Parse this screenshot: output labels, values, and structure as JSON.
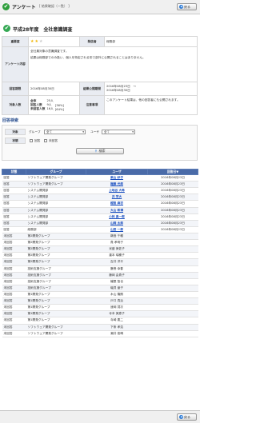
{
  "header": {
    "app_title": "アンケート",
    "breadcrumb": "[ 結果確認（一覧） ]",
    "back_label": "戻る"
  },
  "survey": {
    "title": "平成28年度　全社意識調査"
  },
  "info": {
    "importance_label": "重要度",
    "importance_value": 2,
    "importance_max": 3,
    "sender_label": "発信者",
    "sender_value": "総務部",
    "content_label": "アンケート内容",
    "content_lines": [
      "全社員対象の意識調査です。",
      "結果は総務部でのみ扱い、個人を特定される形で部外に公開されることはありません。"
    ],
    "due_label": "回答期限",
    "due_value": "2016年08月30日",
    "period_label": "結果公開期間",
    "period_value_1": "2016年08月23日　〜",
    "period_value_2": "2016年08月30日",
    "target_label": "対象人数",
    "target_rows": [
      {
        "name": "全体",
        "count": "25人",
        "pct": ""
      },
      {
        "name": "回答人数",
        "count": "9人",
        "pct": "[36%]"
      },
      {
        "name": "未回答人数",
        "count": "16人",
        "pct": "[64%]"
      }
    ],
    "notes_label": "注意事項",
    "notes_value": "このアンケート結果は、他の回答者にも公開されます。"
  },
  "search": {
    "section_title": "回答検索",
    "target_label": "対象",
    "group_text": "グループ",
    "group_value": "全て",
    "user_text": "ユーザ",
    "user_value": "全て",
    "status_label": "状態",
    "status_opt1": "回答",
    "status_opt2": "未回答",
    "search_button": "検索"
  },
  "results": {
    "columns": [
      "状態",
      "グループ",
      "ユーザ",
      "回答日▼"
    ],
    "rows": [
      [
        "回答",
        "ソフトウェア開発グループ",
        "柴山 紗子",
        "2016年08月23日"
      ],
      [
        "回答",
        "ソフトウェア開発グループ",
        "権藤 光郎",
        "2016年08月23日"
      ],
      [
        "回答",
        "システム開発部",
        "上地谷 大希",
        "2016年08月23日"
      ],
      [
        "回答",
        "システム開発部",
        "井 宇大",
        "2016年08月23日"
      ],
      [
        "回答",
        "システム開発部",
        "越智 麻衣",
        "2016年08月23日"
      ],
      [
        "回答",
        "システム開発部",
        "大山 和博",
        "2016年08月23日"
      ],
      [
        "回答",
        "システム開発部",
        "小林 真一郎",
        "2016年08月23日"
      ],
      [
        "回答",
        "システム開発部",
        "山岡 太郎",
        "2016年08月23日"
      ],
      [
        "回答",
        "総務部",
        "山田 一郎",
        "2016年08月23日"
      ],
      [
        "未回答",
        "第2開発グループ",
        "鵜島 千穂",
        ""
      ],
      [
        "未回答",
        "第2開発グループ",
        "貴 孝明子",
        ""
      ],
      [
        "未回答",
        "第2開発グループ",
        "米盛 美佐子",
        ""
      ],
      [
        "未回答",
        "第2開発グループ",
        "重本 瑞穂子",
        ""
      ],
      [
        "未回答",
        "第2開発グループ",
        "吉井 洋平",
        ""
      ],
      [
        "未回答",
        "技術支援グループ",
        "藤巻 幸春",
        ""
      ],
      [
        "未回答",
        "技術支援グループ",
        "藤岡 由貴子",
        ""
      ],
      [
        "未回答",
        "技術支援グループ",
        "幡堅 智也",
        ""
      ],
      [
        "未回答",
        "技術支援グループ",
        "磯貝 章子",
        ""
      ],
      [
        "未回答",
        "第1開発グループ",
        "木山 隆朗",
        ""
      ],
      [
        "未回答",
        "第1開発グループ",
        "戸口 真治",
        ""
      ],
      [
        "未回答",
        "第1開発グループ",
        "速岡 賢次",
        ""
      ],
      [
        "未回答",
        "第1開発グループ",
        "寺本 美恵子",
        ""
      ],
      [
        "未回答",
        "第1開発グループ",
        "寺崎 要二",
        ""
      ],
      [
        "未回答",
        "ソフトウェア開発グループ",
        "下条 孝浩",
        ""
      ],
      [
        "未回答",
        "ソフトウェア開発グループ",
        "潮井 俊晴",
        ""
      ]
    ]
  }
}
